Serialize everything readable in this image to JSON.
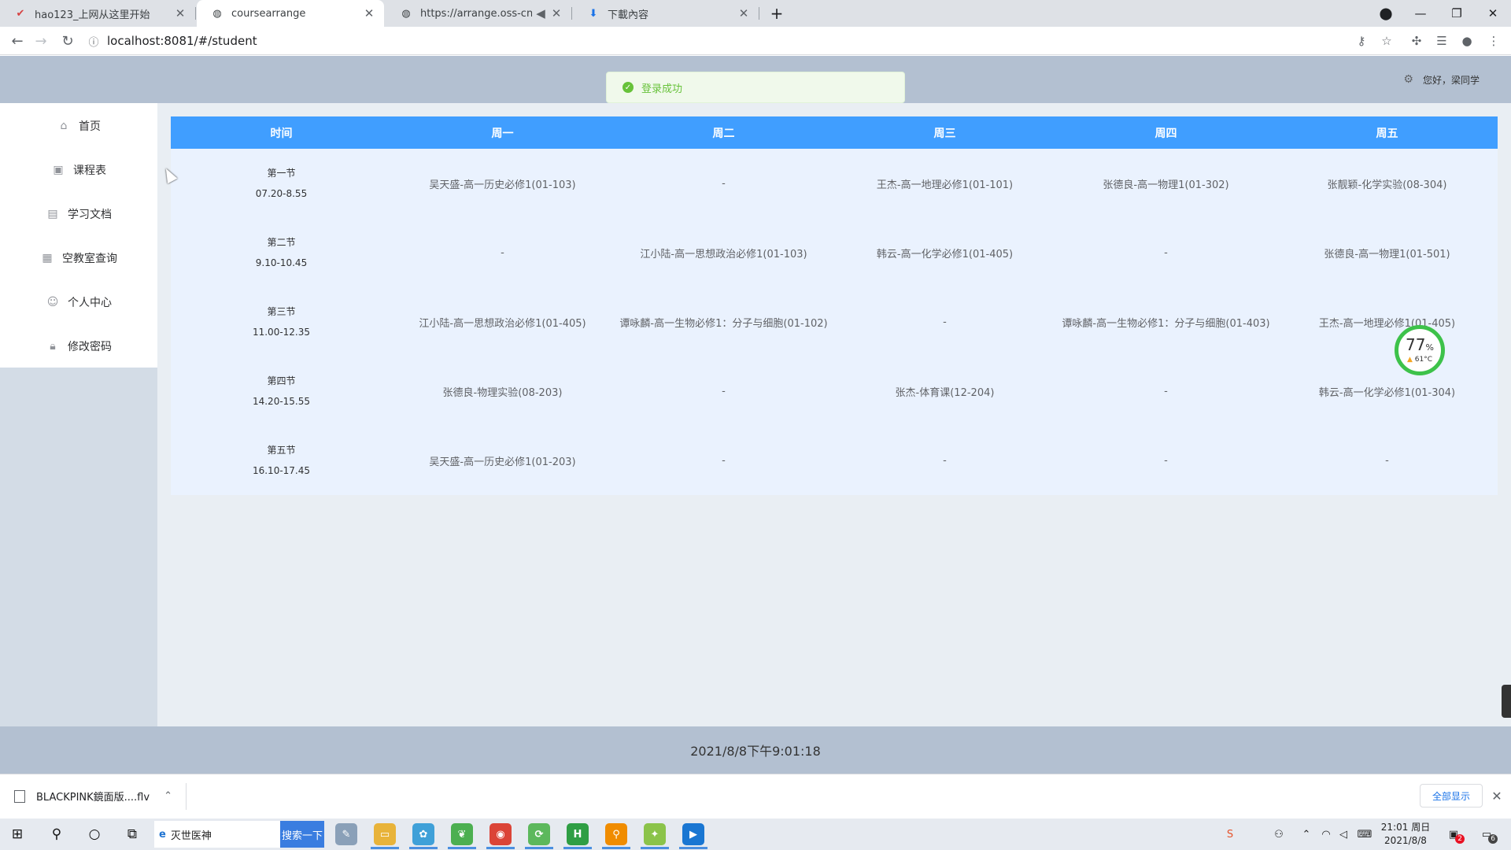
{
  "browser": {
    "tabs": [
      {
        "title": "hao123_上网从这里开始",
        "icon": "hao123-icon",
        "active": false
      },
      {
        "title": "coursearrange",
        "icon": "globe-icon",
        "active": true
      },
      {
        "title": "https://arrange.oss-cn-she",
        "icon": "globe-icon",
        "active": false,
        "muted_icon": "speaker-icon"
      },
      {
        "title": "下載內容",
        "icon": "download-icon",
        "active": false
      }
    ],
    "url": "localhost:8081/#/student"
  },
  "app": {
    "greeting": "您好，梁同学",
    "toast": "登录成功",
    "menu": [
      {
        "label": "首页",
        "icon": "home-icon"
      },
      {
        "label": "课程表",
        "icon": "chart-icon"
      },
      {
        "label": "学习文档",
        "icon": "document-icon"
      },
      {
        "label": "空教室查询",
        "icon": "building-icon"
      },
      {
        "label": "个人中心",
        "icon": "user-icon"
      },
      {
        "label": "修改密码",
        "icon": "lock-icon"
      }
    ],
    "schedule": {
      "headers": [
        "时间",
        "周一",
        "周二",
        "周三",
        "周四",
        "周五"
      ],
      "rows": [
        {
          "period": "第一节",
          "time": "07.20-8.55",
          "cells": [
            "吴天盛-高一历史必修1(01-103)",
            "-",
            "王杰-高一地理必修1(01-101)",
            "张德良-高一物理1(01-302)",
            "张靓颖-化学实验(08-304)"
          ]
        },
        {
          "period": "第二节",
          "time": "9.10-10.45",
          "cells": [
            "-",
            "江小陆-高一思想政治必修1(01-103)",
            "韩云-高一化学必修1(01-405)",
            "-",
            "张德良-高一物理1(01-501)"
          ]
        },
        {
          "period": "第三节",
          "time": "11.00-12.35",
          "cells": [
            "江小陆-高一思想政治必修1(01-405)",
            "谭咏麟-高一生物必修1：分子与细胞(01-102)",
            "-",
            "谭咏麟-高一生物必修1：分子与细胞(01-403)",
            "王杰-高一地理必修1(01-405)"
          ]
        },
        {
          "period": "第四节",
          "time": "14.20-15.55",
          "cells": [
            "张德良-物理实验(08-203)",
            "-",
            "张杰-体育课(12-204)",
            "-",
            "韩云-高一化学必修1(01-304)"
          ]
        },
        {
          "period": "第五节",
          "time": "16.10-17.45",
          "cells": [
            "吴天盛-高一历史必修1(01-203)",
            "-",
            "-",
            "-",
            "-"
          ]
        }
      ]
    },
    "footer_time": "2021/8/8下午9:01:18"
  },
  "overlay": {
    "percent": "77",
    "percent_unit": "%",
    "temp": "61°C"
  },
  "download_bar": {
    "file": "BLACKPINK鏡面版....flv",
    "show_all": "全部显示"
  },
  "taskbar": {
    "search_text": "灭世医神",
    "search_button": "搜索一下",
    "clock_time": "21:01 周日",
    "clock_date": "2021/8/8",
    "notif_count": "2",
    "action_count": "6"
  }
}
